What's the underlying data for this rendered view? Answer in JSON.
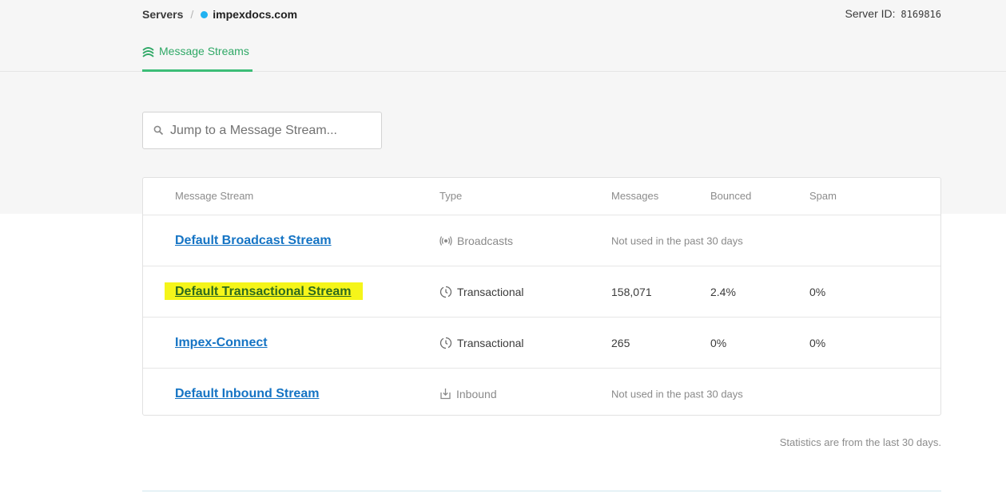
{
  "breadcrumb": {
    "servers_label": "Servers",
    "separator": "/",
    "current_server": "impexdocs.com",
    "status_color": "#21b2f1"
  },
  "server_id": {
    "label": "Server ID:",
    "value": "8169816"
  },
  "tabs": [
    {
      "label": "Message Streams",
      "icon": "message-streams-icon",
      "active": true
    }
  ],
  "search": {
    "placeholder": "Jump to a Message Stream...",
    "value": ""
  },
  "table": {
    "headers": {
      "stream": "Message Stream",
      "type": "Type",
      "messages": "Messages",
      "bounced": "Bounced",
      "spam": "Spam"
    },
    "rows": [
      {
        "name": "Default Broadcast Stream",
        "type": "Broadcasts",
        "type_icon": "broadcast-icon",
        "messages": "",
        "bounced": "",
        "spam": "",
        "status": "Not used in the past 30 days",
        "highlighted": false
      },
      {
        "name": "Default Transactional Stream",
        "type": "Transactional",
        "type_icon": "transactional-icon",
        "messages": "158,071",
        "bounced": "2.4%",
        "spam": "0%",
        "status": "",
        "highlighted": true
      },
      {
        "name": "Impex-Connect",
        "type": "Transactional",
        "type_icon": "transactional-icon",
        "messages": "265",
        "bounced": "0%",
        "spam": "0%",
        "status": "",
        "highlighted": false
      },
      {
        "name": "Default Inbound Stream",
        "type": "Inbound",
        "type_icon": "inbound-icon",
        "messages": "",
        "bounced": "",
        "spam": "",
        "status": "Not used in the past 30 days",
        "highlighted": false
      }
    ]
  },
  "footnote": "Statistics are from the last 30 days.",
  "colors": {
    "link": "#1574c4",
    "accent_green": "#3cbd77",
    "highlight": "#f5f51a"
  }
}
